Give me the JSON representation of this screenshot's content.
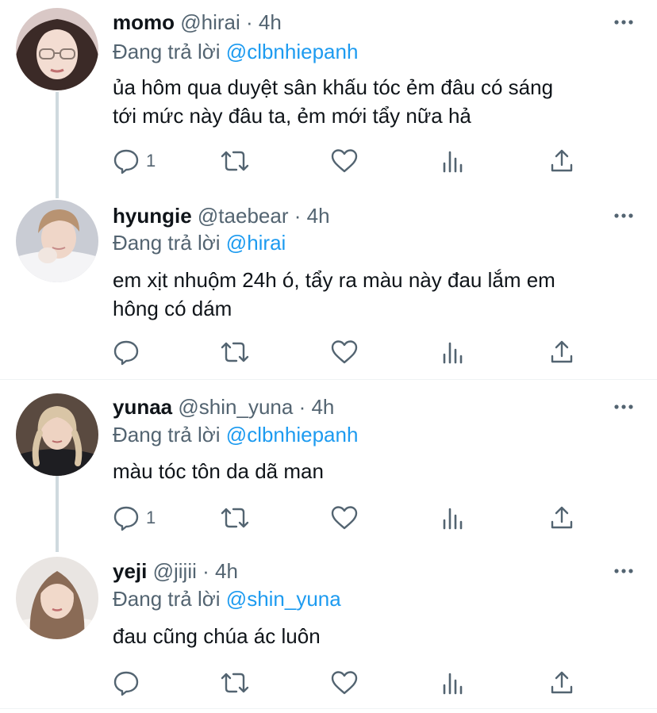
{
  "replying_prefix": "Đang trả lời",
  "tweets": [
    {
      "name": "momo",
      "handle": "@hirai",
      "dot": "·",
      "time": "4h",
      "reply_to": "@clbnhiepanh",
      "lines": [
        "ủa hôm qua duyệt sân khấu tóc ẻm đâu có sáng",
        "tới mức này đâu ta, ẻm mới tẩy nữa hả"
      ],
      "reply_count": "1"
    },
    {
      "name": "hyungie",
      "handle": "@taebear",
      "dot": "·",
      "time": "4h",
      "reply_to": "@hirai",
      "lines": [
        "em xịt nhuộm 24h ó, tẩy ra màu này đau lắm em",
        "hông có dám"
      ],
      "reply_count": ""
    },
    {
      "name": "yunaa",
      "handle": "@shin_yuna",
      "dot": "·",
      "time": "4h",
      "reply_to": "@clbnhiepanh",
      "lines": [
        "màu tóc tôn da dã man"
      ],
      "reply_count": "1"
    },
    {
      "name": "yeji",
      "handle": "@jijii",
      "dot": "·",
      "time": "4h",
      "reply_to": "@shin_yuna",
      "lines": [
        "đau cũng chúa ác luôn"
      ],
      "reply_count": ""
    }
  ],
  "icons": {
    "reply": "speech-bubble-icon",
    "retweet": "retweet-icon",
    "like": "heart-icon",
    "stats": "bar-chart-icon",
    "share": "share-upload-icon",
    "more": "more-dots-icon"
  },
  "colors": {
    "text": "#0f1419",
    "secondary": "#536471",
    "link": "#1d9bf0",
    "thread_line": "#cfd9de",
    "divider": "#eff3f4"
  }
}
